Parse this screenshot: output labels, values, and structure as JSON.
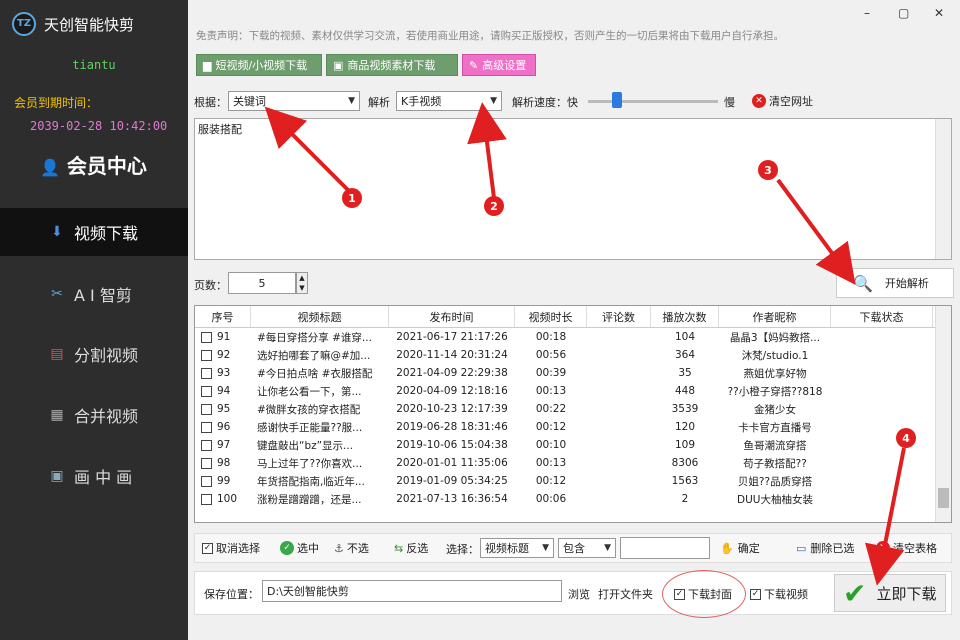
{
  "app": {
    "logo": "TZ",
    "title": "天创智能快剪",
    "user": "tiantu",
    "expire_label": "会员到期时间：",
    "expire_date": "2039-02-28 10:42:00",
    "member_center": "会员中心"
  },
  "nav": [
    {
      "label": "视频下载",
      "icon": "down-arrow-icon"
    },
    {
      "label": "A I 智剪",
      "icon": "ai-cut-icon"
    },
    {
      "label": "分割视频",
      "icon": "split-icon"
    },
    {
      "label": "合并视频",
      "icon": "merge-icon"
    },
    {
      "label": "画 中 画",
      "icon": "pip-icon"
    }
  ],
  "window": {
    "min": "–",
    "max": "▢",
    "close": "✕"
  },
  "disclaimer": "免责声明：下载的视频、素材仅供学习交流，若使用商业用途，请购买正版授权，否则产生的一切后果将由下载用户自行承担。",
  "tabs": [
    "短视频/小视频下载",
    "商品视频素材下载",
    "高级设置"
  ],
  "filters": {
    "basis_label": "根据：",
    "basis": "关键词",
    "parse_label": "解析",
    "parse": "K手视频",
    "speed_label": "解析速度：快",
    "slow": "慢",
    "clear_url": "清空网址"
  },
  "input_text": "服装搭配",
  "pages": {
    "label": "页数：",
    "value": "5"
  },
  "start_parse": "开始解析",
  "table": {
    "headers": [
      "序号",
      "视频标题",
      "发布时间",
      "视频时长",
      "评论数",
      "播放次数",
      "作者昵称",
      "下载状态"
    ],
    "rows": [
      [
        "91",
        "#每日穿搭分享 #谁穿...",
        "2021-06-17 21:17:26",
        "00:18",
        "",
        "104",
        "晶晶3【妈妈教搭...",
        ""
      ],
      [
        "92",
        "选好拍哪套了嘛@#加...",
        "2020-11-14 20:31:24",
        "00:56",
        "",
        "364",
        "沐梵/studio.1",
        ""
      ],
      [
        "93",
        "#今日拍点啥 #衣服搭配",
        "2021-04-09 22:29:38",
        "00:39",
        "",
        "35",
        "燕姐优享好物",
        ""
      ],
      [
        "94",
        "让你老公看一下，第...",
        "2020-04-09 12:18:16",
        "00:13",
        "",
        "448",
        "??小橙子穿搭??818",
        ""
      ],
      [
        "95",
        "#微胖女孩的穿衣搭配",
        "2020-10-23 12:17:39",
        "00:22",
        "",
        "3539",
        "金猪少女",
        ""
      ],
      [
        "96",
        "感谢快手正能量??服...",
        "2019-06-28 18:31:46",
        "00:12",
        "",
        "120",
        "卡卡官方直播号",
        ""
      ],
      [
        "97",
        "键盘敲出“bz”显示...",
        "2019-10-06 15:04:38",
        "00:10",
        "",
        "109",
        "鱼哥潮流穿搭",
        ""
      ],
      [
        "98",
        "马上过年了??你喜欢...",
        "2020-01-01 11:35:06",
        "00:13",
        "",
        "8306",
        "苟子教搭配??",
        ""
      ],
      [
        "99",
        "年货搭配指南,临近年...",
        "2019-01-09 05:34:25",
        "00:12",
        "",
        "1563",
        "贝姐??品质穿搭",
        ""
      ],
      [
        "100",
        "涨粉是蹭蹭蹭，还是...",
        "2021-07-13 16:36:54",
        "00:06",
        "",
        "2",
        "DUU大柚柚女装",
        ""
      ]
    ]
  },
  "actions": {
    "deselect": "取消选择",
    "select": "选中",
    "unselect": "不选",
    "invert": "反选",
    "choose_label": "选择：",
    "field": "视频标题",
    "match": "包含",
    "confirm": "确定",
    "delete_selected": "删除已选",
    "clear_table": "清空表格"
  },
  "save": {
    "label": "保存位置：",
    "path": "D:\\天创智能快剪",
    "browse": "浏览",
    "open_folder": "打开文件夹"
  },
  "options": {
    "cover": "下载封面",
    "video": "下载视频"
  },
  "download_now": "立即下载",
  "callouts": [
    "1",
    "2",
    "3",
    "4"
  ]
}
